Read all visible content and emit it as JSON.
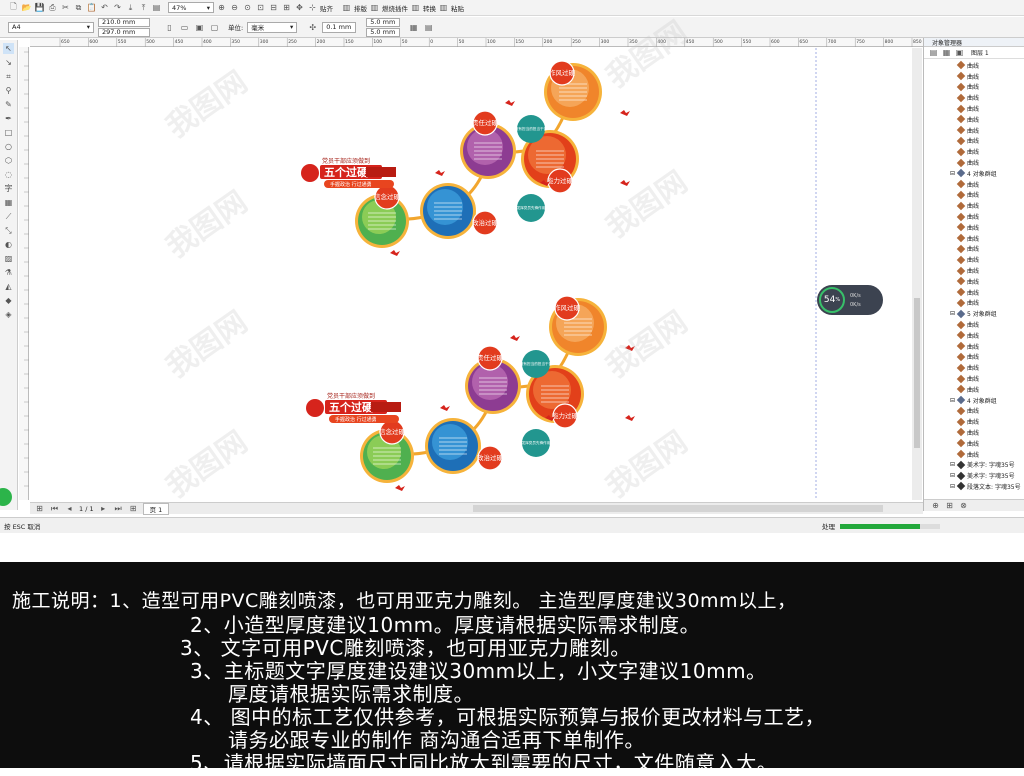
{
  "toolbar": {
    "zoom": "47%",
    "snap_label": "贴齐",
    "dist_label": "排版",
    "plugin_label": "燃烧插件",
    "transform_label": "转换",
    "paste_label": "粘贴"
  },
  "propbar": {
    "page_size": "A4",
    "width": "210.0 mm",
    "height": "297.0 mm",
    "unit_label": "单位:",
    "unit": "毫米",
    "nudge": "0.1 mm",
    "dup_x": "5.0 mm",
    "dup_y": "5.0 mm"
  },
  "ruler_ticks": [
    "650",
    "600",
    "550",
    "500",
    "450",
    "400",
    "350",
    "300",
    "250",
    "200",
    "150",
    "100",
    "50",
    "0",
    "50",
    "100",
    "150",
    "200",
    "250",
    "300",
    "350",
    "400",
    "450",
    "500",
    "550",
    "600",
    "650",
    "700",
    "750",
    "800",
    "850"
  ],
  "design": {
    "header": "党员干部应须做到",
    "title": "五个过硬",
    "subtitle": "手握政治 行过通勇",
    "badges": [
      "作风过硬",
      "责任过硬",
      "能力过硬",
      "信念过硬",
      "政治过硬"
    ],
    "teal1": "做有担当的担当干部",
    "teal2": "发挥党员先锋作用"
  },
  "dock": {
    "title": "对象管理器",
    "layer": "图层 1",
    "items": [
      "曲线",
      "曲线",
      "曲线",
      "曲线",
      "曲线",
      "曲线",
      "曲线",
      "曲线",
      "曲线",
      "曲线",
      "4 对象群组",
      "曲线",
      "曲线",
      "曲线",
      "曲线",
      "曲线",
      "曲线",
      "曲线",
      "曲线",
      "曲线",
      "曲线",
      "曲线",
      "曲线",
      "5 对象群组",
      "曲线",
      "曲线",
      "曲线",
      "曲线",
      "曲线",
      "曲线",
      "曲线",
      "4 对象群组",
      "曲线",
      "曲线",
      "曲线",
      "曲线",
      "曲线",
      "美术字: 字魂35号",
      "美术字: 字魂35号",
      "段落文本: 字魂35号"
    ]
  },
  "pagenav": {
    "count": "1 / 1",
    "tab": "页 1"
  },
  "status": {
    "hint": "按 ESC 取消",
    "process": "处理",
    "progress": 0.8
  },
  "perf": {
    "value": "54",
    "unit": "%",
    "up": "0K/s",
    "down": "0K/s"
  },
  "notes": [
    "施工说明：1、造型可用PVC雕刻喷漆，也可用亚克力雕刻。  主造型厚度建议30mm以上，",
    "2、小造型厚度建议10mm。厚度请根据实际需求制度。",
    "3、 文字可用PVC雕刻喷漆，也可用亚克力雕刻。",
    "3、主标题文字厚度建设建议30mm以上，小文字建议10mm。",
    "厚度请根据实际需求制度。",
    "4、 图中的标工艺仅供参考，可根据实际预算与报价更改材料与工艺，",
    "请务必跟专业的制作 商沟通合适再下单制作。",
    "5、请根据实际墙面尺寸同比放大到需要的尺寸，文件随意入大。"
  ],
  "watermark": "我图网"
}
